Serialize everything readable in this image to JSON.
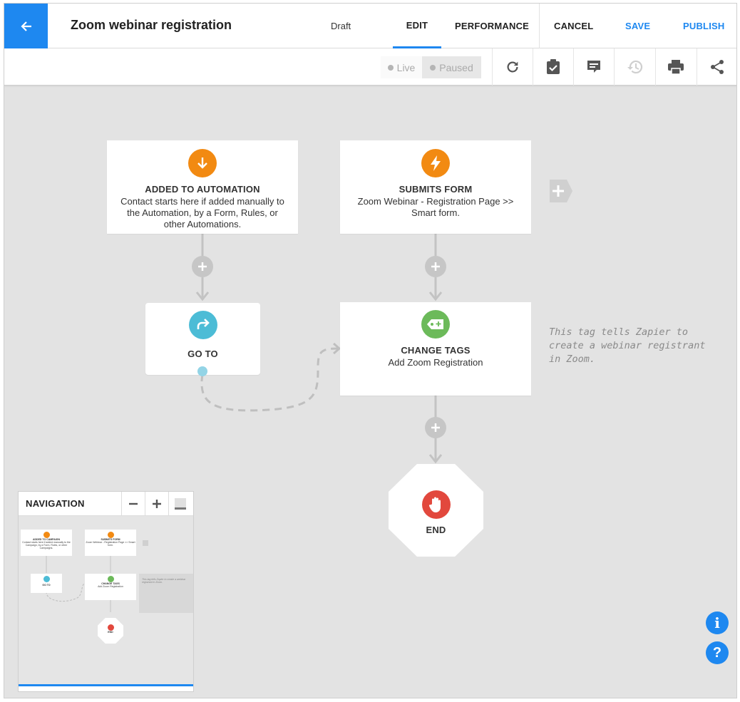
{
  "header": {
    "title": "Zoom webinar registration",
    "status": "Draft",
    "tabs": [
      {
        "label": "EDIT",
        "active": true
      },
      {
        "label": "PERFORMANCE",
        "active": false
      }
    ],
    "cancel_label": "CANCEL",
    "save_label": "SAVE",
    "publish_label": "PUBLISH",
    "accent_color": "#1e88f0"
  },
  "toolbar": {
    "toggle": {
      "live_label": "Live",
      "paused_label": "Paused",
      "selected": "Paused"
    },
    "icons": [
      "refresh-icon",
      "clipboard-check-icon",
      "notes-icon",
      "history-icon",
      "print-icon",
      "share-icon"
    ]
  },
  "workflow": {
    "trigger_1": {
      "title": "ADDED TO AUTOMATION",
      "description": "Contact starts here if added manually to the Automation, by a Form, Rules, or other Automations.",
      "icon": "arrow-down-icon",
      "color": "#f28a12"
    },
    "trigger_2": {
      "title": "SUBMITS FORM",
      "description": "Zoom Webinar - Registration Page >> Smart form.",
      "icon": "lightning-icon",
      "color": "#f28a12"
    },
    "goto": {
      "title": "GO TO",
      "icon": "redirect-icon",
      "color": "#4cbcd6"
    },
    "change_tags": {
      "title": "CHANGE TAGS",
      "description": "Add Zoom Registration",
      "icon": "tag-icon",
      "color": "#6cba5a"
    },
    "note": "This tag tells Zapier to create a webinar registrant in Zoom.",
    "end": {
      "title": "END",
      "icon": "stop-hand-icon",
      "color": "#e2483d"
    }
  },
  "navigation": {
    "title": "NAVIGATION",
    "mini_map": {
      "trigger_1_title": "ADDED TO CAMPAIGN",
      "trigger_1_desc": "Contact starts here if added manually to the Campaign, by a Form, Rules, or other Campaigns.",
      "trigger_2_title": "SUBMITS FORM",
      "trigger_2_desc": "Zoom Webinar - Registration Page >> Smart form.",
      "goto_title": "GO TO",
      "tags_title": "CHANGE TAGS",
      "tags_desc": "Add Zoom Registration",
      "note": "This tag tells Zapier to create a webinar registrant in Zoom.",
      "end_title": "END"
    }
  },
  "help": {
    "info_label": "i",
    "help_label": "?"
  }
}
